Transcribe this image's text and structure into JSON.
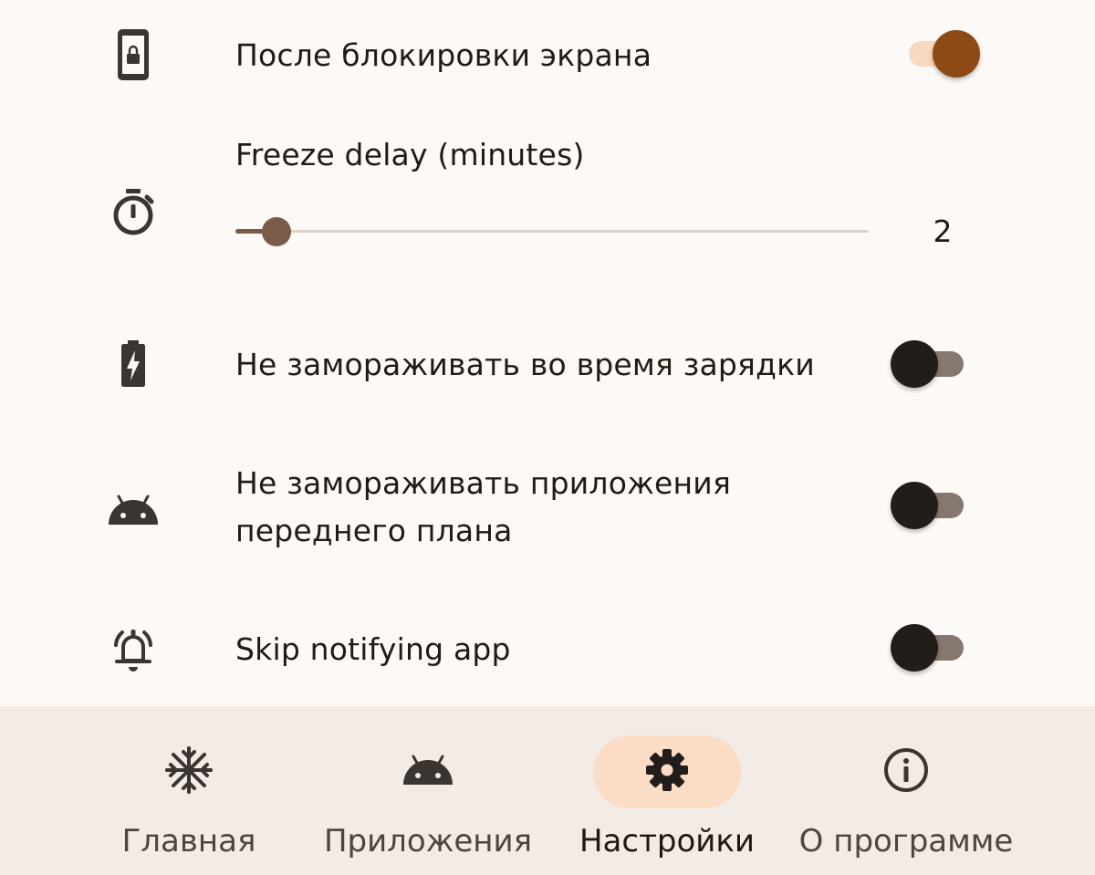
{
  "settings": {
    "screen_lock": {
      "label": "После блокировки экрана",
      "icon": "phone-lock-icon",
      "enabled": true
    },
    "freeze_delay": {
      "label": "Freeze delay (minutes)",
      "icon": "timer-icon",
      "value": "2",
      "fraction": 0.065
    },
    "charging": {
      "label": "Не замораживать во время зарядки",
      "icon": "battery-charging-icon",
      "enabled": false
    },
    "foreground": {
      "label_line1": "Не замораживать приложения",
      "label_line2": "переднего плана",
      "icon": "android-icon",
      "enabled": false
    },
    "notifying": {
      "label": "Skip notifying app",
      "icon": "notification-alarm-icon",
      "enabled": false
    }
  },
  "bottom_nav": {
    "items": [
      {
        "label": "Главная",
        "icon": "snowflake-icon",
        "active": false
      },
      {
        "label": "Приложения",
        "icon": "android-icon",
        "active": false
      },
      {
        "label": "Настройки",
        "icon": "gear-icon",
        "active": true
      },
      {
        "label": "О программе",
        "icon": "info-icon",
        "active": false
      }
    ]
  },
  "colors": {
    "background": "#fdf9f6",
    "accent": "#8d4a14",
    "accent_container": "#fbdcc5",
    "nav_background": "#f3ebe6"
  }
}
